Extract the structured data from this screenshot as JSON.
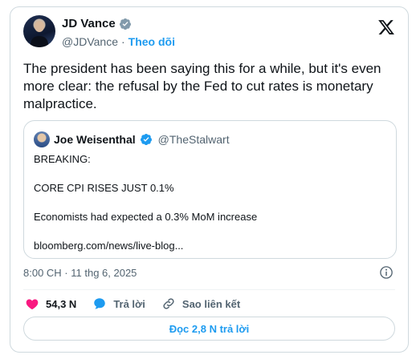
{
  "tweet": {
    "author": {
      "display_name": "JD Vance",
      "handle": "@JDVance",
      "separator": "·",
      "follow_label": "Theo dõi"
    },
    "text": "The president has been saying this for a while, but it's even more clear: the refusal by the Fed to cut rates is monetary malpractice.",
    "timestamp": "8:00 CH · 11 thg 6, 2025"
  },
  "quote": {
    "author": {
      "display_name": "Joe Weisenthal",
      "handle": "@TheStalwart"
    },
    "lines": [
      "BREAKING:",
      "CORE CPI RISES JUST 0.1%",
      "Economists had expected a 0.3% MoM increase",
      "bloomberg.com/news/live-blog..."
    ]
  },
  "actions": {
    "like_count": "54,3 N",
    "reply_label": "Trả lời",
    "copy_link_label": "Sao liên kết"
  },
  "read_replies_label": "Đọc 2,8 N trả lời",
  "colors": {
    "accent": "#1d9bf0",
    "like": "#f91880",
    "secondary_text": "#536471",
    "border": "#cfd9de"
  },
  "icons": [
    "verified-badge-icon",
    "x-logo-icon",
    "info-icon",
    "heart-icon",
    "reply-bubble-icon",
    "link-icon"
  ]
}
